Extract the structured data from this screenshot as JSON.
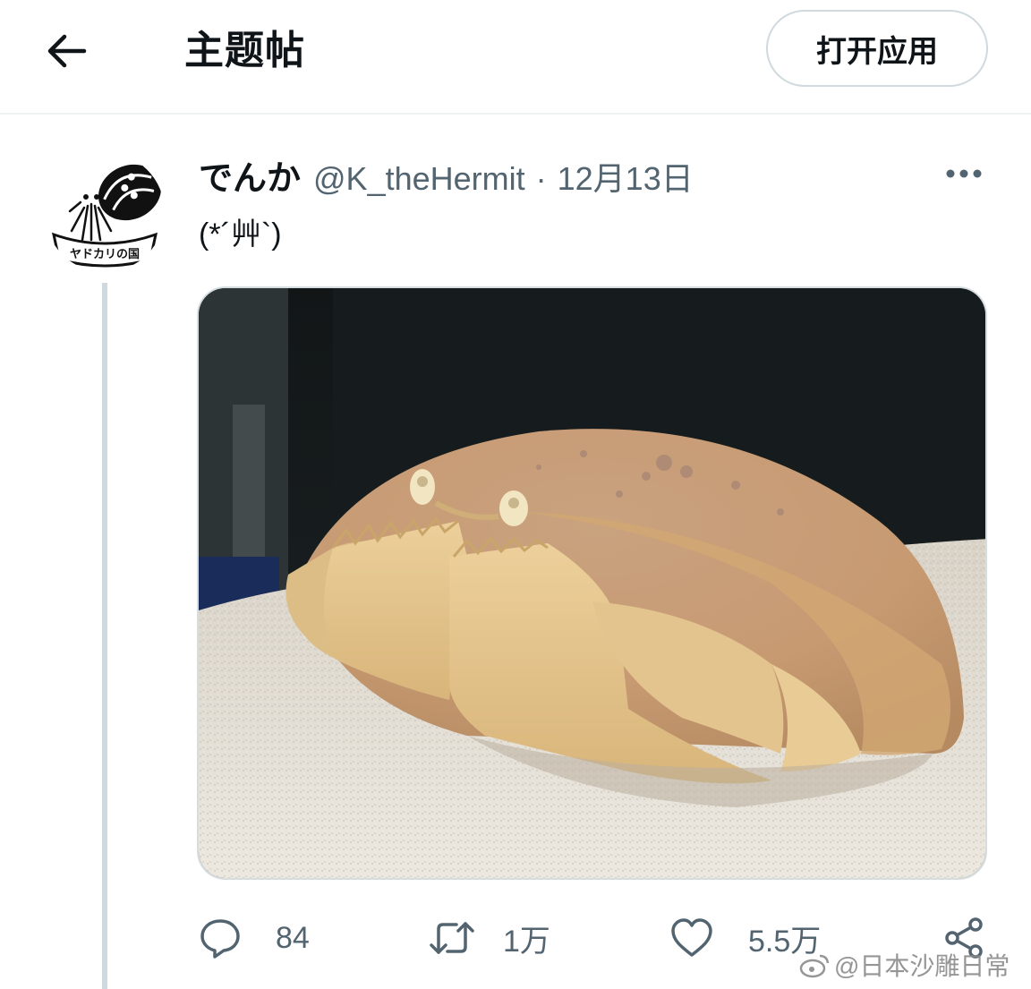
{
  "header": {
    "title": "主题帖",
    "open_app_label": "打开应用"
  },
  "tweet": {
    "avatar_label": "ヤドカリの国",
    "display_name": "でんか",
    "handle": "@K_theHermit",
    "separator": "·",
    "date": "12月13日",
    "text": "(*´艸`)"
  },
  "actions": {
    "reply_count": "84",
    "retweet_count": "1万",
    "like_count": "5.5万"
  },
  "watermark": {
    "text": "@日本沙雕日常"
  },
  "colors": {
    "text_primary": "#0f1419",
    "text_secondary": "#536471",
    "border": "#cfd9de"
  }
}
